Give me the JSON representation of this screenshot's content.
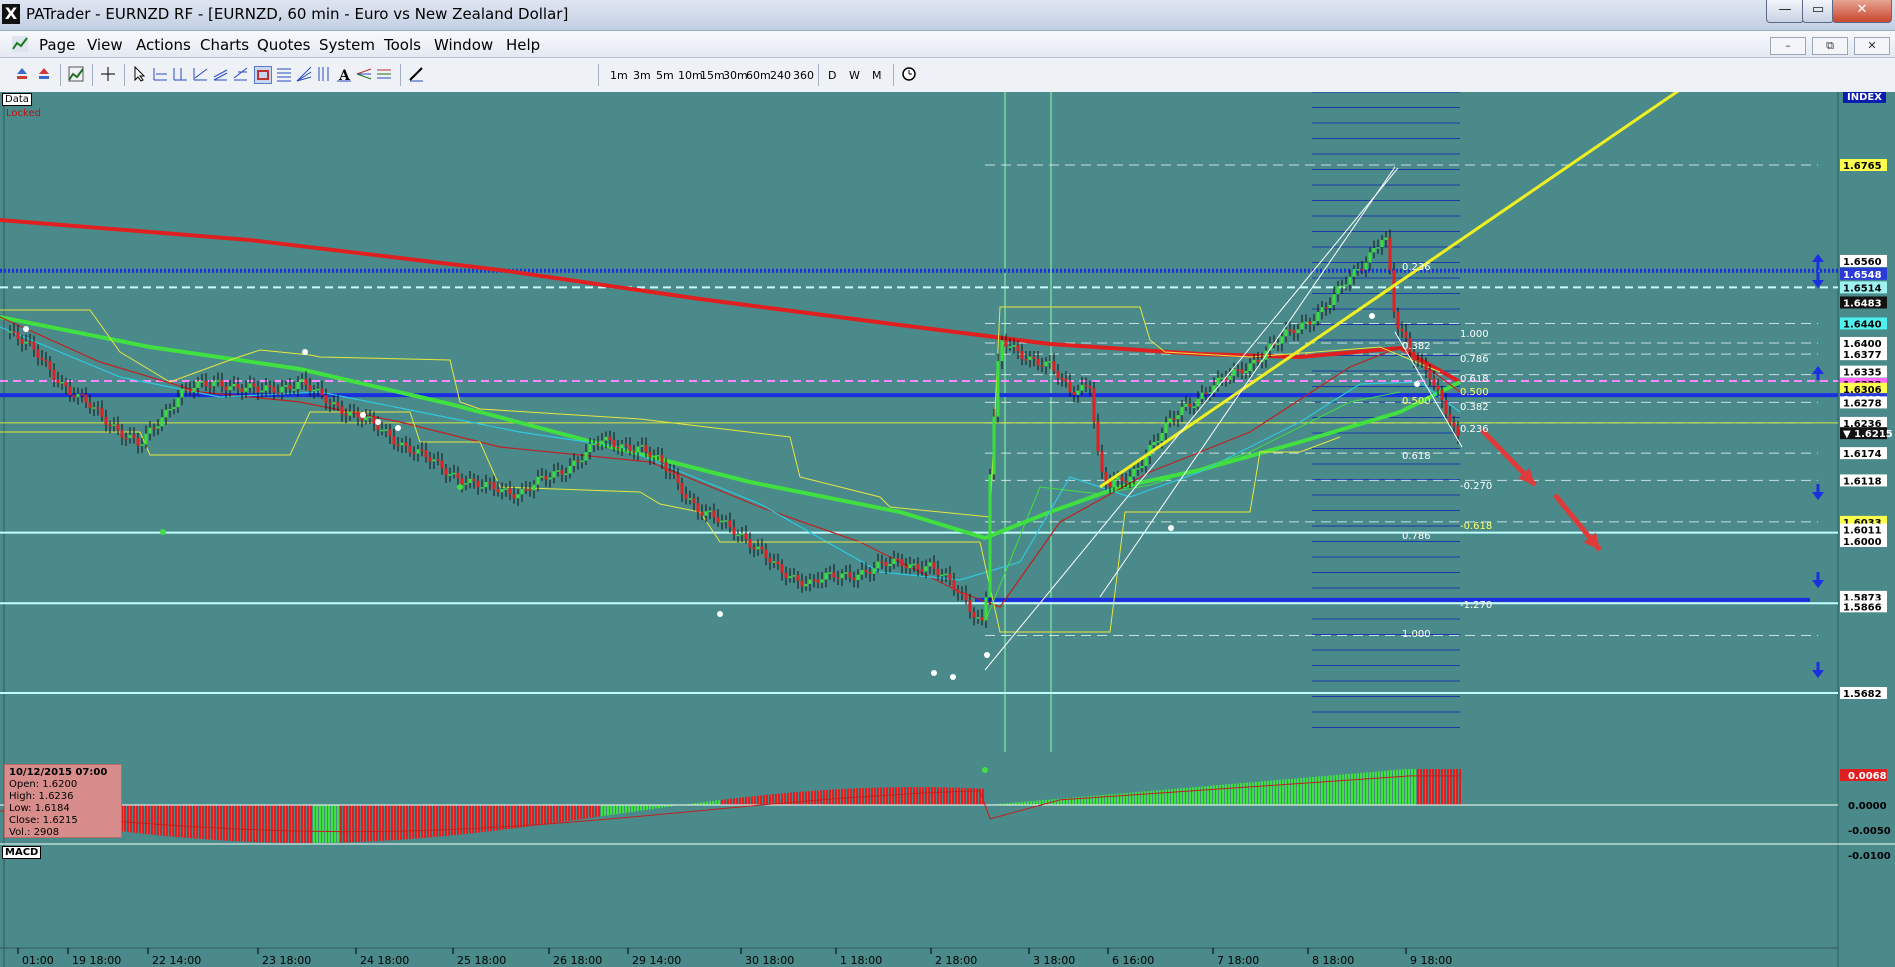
{
  "window": {
    "title": "PATrader - EURNZD RF - [EURNZD, 60 min - Euro vs New Zealand Dollar]",
    "app_icon": "X",
    "buttons": {
      "minimize": "—",
      "maximize": "▭",
      "close": "✕"
    }
  },
  "menu": {
    "items": [
      "Page",
      "View",
      "Actions",
      "Charts",
      "Quotes",
      "System",
      "Tools",
      "Window",
      "Help"
    ],
    "mdi": {
      "minimize": "–",
      "restore": "⧉",
      "close": "✕"
    }
  },
  "toolbar": {
    "timeframes": [
      "1m",
      "3m",
      "5m",
      "10m",
      "15m",
      "30m",
      "60m",
      "240",
      "360"
    ],
    "periods": [
      "D",
      "W",
      "M"
    ]
  },
  "chart": {
    "data_tab": "Data",
    "locked_label": "Locked",
    "index_label": "INDEX",
    "macd_label": "MACD"
  },
  "info_panel": {
    "datetime": "10/12/2015 07:00",
    "open": "Open: 1.6200",
    "high": "High: 1.6236",
    "low": "Low: 1.6184",
    "close": "Close: 1.6215",
    "vol": "Vol.: 2908"
  },
  "chart_data": {
    "type": "line",
    "symbol": "EURNZD",
    "timeframe": "60 min",
    "x_ticks": [
      "01:00",
      "19 18:00",
      "22 14:00",
      "23 18:00",
      "24 18:00",
      "25 18:00",
      "26 18:00",
      "29 14:00",
      "30 18:00",
      "1 18:00",
      "2 18:00",
      "3 18:00",
      "6 16:00",
      "7 18:00",
      "8 18:00",
      "9 18:00"
    ],
    "price_labels": [
      {
        "value": "1.6765",
        "bg": "#ffff4d"
      },
      {
        "value": "1.6560",
        "bg": "#ffffff"
      },
      {
        "value": "1.6548",
        "bg": "#2a3ad8"
      },
      {
        "value": "1.6514",
        "bg": "#9ff2f2"
      },
      {
        "value": "1.6483",
        "bg": "#111111"
      },
      {
        "value": "1.6440",
        "bg": "#50f0f0"
      },
      {
        "value": "1.6400",
        "bg": "#ffffff"
      },
      {
        "value": "1.6377",
        "bg": "#ffffff"
      },
      {
        "value": "1.6335",
        "bg": "#ffffff"
      },
      {
        "value": "1.6322",
        "bg": "#ff66ff"
      },
      {
        "value": "1.6306",
        "bg": "#ffff4d"
      },
      {
        "value": "1.6293",
        "bg": "#2a3ad8"
      },
      {
        "value": "1.6278",
        "bg": "#ffffff"
      },
      {
        "value": "1.6236",
        "bg": "#ffffff"
      },
      {
        "value": "1.6215",
        "bg": "#111111"
      },
      {
        "value": "1.6174",
        "bg": "#ffffff"
      },
      {
        "value": "1.6118",
        "bg": "#ffffff"
      },
      {
        "value": "1.6033",
        "bg": "#ffff4d"
      },
      {
        "value": "1.6011",
        "bg": "#ffffff"
      },
      {
        "value": "1.6000",
        "bg": "#ffffff"
      },
      {
        "value": "1.5873",
        "bg": "#ffffff"
      },
      {
        "value": "1.5866",
        "bg": "#ffffff"
      },
      {
        "value": "1.5682",
        "bg": "#ffffff"
      }
    ],
    "fib_labels": [
      "1.000",
      "0.786",
      "0.618",
      "0.500",
      "0.382",
      "0.236",
      "-0.270",
      "-0.618",
      "-1.270",
      "0.382",
      "0.500",
      "0.618",
      "0.786",
      "1.000",
      "0.236"
    ],
    "macd_labels": [
      "0.0068",
      "0.0000",
      "-0.0050",
      "-0.0100"
    ],
    "horizontal_levels": [
      {
        "price": 1.6548,
        "color": "#1a2fe0",
        "style": "dotted-thick"
      },
      {
        "price": 1.6514,
        "color": "#ccffff",
        "style": "dashed"
      },
      {
        "price": 1.6322,
        "color": "#ff88ff",
        "style": "dashed"
      },
      {
        "price": 1.6293,
        "color": "#1a2fe0",
        "style": "solid-thick"
      },
      {
        "price": 1.6011,
        "color": "#bfffff",
        "style": "solid"
      },
      {
        "price": 1.5873,
        "color": "#1a2fe0",
        "style": "solid-thick"
      },
      {
        "price": 1.5866,
        "color": "#bfffff",
        "style": "solid"
      },
      {
        "price": 1.5682,
        "color": "#bfffff",
        "style": "solid"
      }
    ],
    "ylim": [
      1.568,
      1.69
    ]
  }
}
